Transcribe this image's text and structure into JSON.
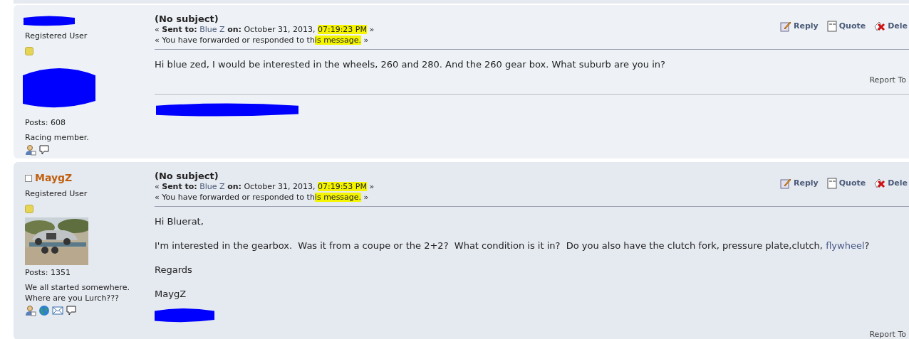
{
  "posts": [
    {
      "author": {
        "kind": "redacted"
      },
      "rank": "Registered User",
      "avatar": {
        "kind": "redacted"
      },
      "post_count": "Posts: 608",
      "personal_text": [
        "Racing member."
      ],
      "profile_icons": [
        {
          "kind": "profile"
        },
        {
          "kind": "message"
        }
      ],
      "subject": "(No subject)",
      "sent": {
        "open": "«",
        "label": "Sent to:",
        "recipient": "Blue Z",
        "on_label": "on:",
        "date": "October 31, 2013,",
        "time": "07:19:23 PM",
        "time_highlighted": true,
        "close": "»"
      },
      "status": [
        {
          "text": "« You have forwarded or responded to th",
          "highlighted": false
        },
        {
          "text": "is message.",
          "highlighted": true
        },
        {
          "text": " »",
          "highlighted": false
        }
      ],
      "actions": [
        {
          "kind": "reply",
          "label": "Reply"
        },
        {
          "kind": "quote",
          "label": "Quote"
        },
        {
          "kind": "delete",
          "label": "Dele"
        }
      ],
      "body": [
        [
          {
            "kind": "text",
            "text": "Hi blue zed, I would be interested in the wheels, 260 and 280. And the 260 gear box. What suburb are you in?"
          }
        ]
      ],
      "body_scribble": false,
      "report": "Report To",
      "signature_scribble": true
    },
    {
      "author": {
        "kind": "name",
        "name": "MaygZ",
        "online": false
      },
      "rank": "Registered User",
      "avatar": {
        "kind": "picture"
      },
      "post_count": "Posts: 1351",
      "personal_text": [
        "We all started somewhere.",
        "Where are you Lurch???"
      ],
      "profile_icons": [
        {
          "kind": "profile"
        },
        {
          "kind": "globe"
        },
        {
          "kind": "email"
        },
        {
          "kind": "message"
        }
      ],
      "subject": "(No subject)",
      "sent": {
        "open": "«",
        "label": "Sent to:",
        "recipient": "Blue Z",
        "on_label": "on:",
        "date": "October 31, 2013,",
        "time": "07:19:53 PM",
        "time_highlighted": true,
        "close": "»"
      },
      "status": [
        {
          "text": "« You have forwarded or responded to th",
          "highlighted": false
        },
        {
          "text": "is message.",
          "highlighted": true
        },
        {
          "text": " »",
          "highlighted": false
        }
      ],
      "actions": [
        {
          "kind": "reply",
          "label": "Reply"
        },
        {
          "kind": "quote",
          "label": "Quote"
        },
        {
          "kind": "delete",
          "label": "Dele"
        }
      ],
      "body": [
        [
          {
            "kind": "text",
            "text": "Hi Bluerat,"
          }
        ],
        [
          {
            "kind": "text",
            "text": "I'm interested in the gearbox.  Was it from a coupe or the 2+2?  What condition is it in?  Do you also have the clutch fork, pressure plate,clutch, "
          },
          {
            "kind": "link",
            "text": "flywheel"
          },
          {
            "kind": "text",
            "text": "?"
          }
        ],
        [
          {
            "kind": "text",
            "text": "Regards"
          }
        ],
        [
          {
            "kind": "text",
            "text": "MaygZ"
          }
        ]
      ],
      "body_scribble": true,
      "report": "Report To",
      "signature_scribble": false
    }
  ]
}
